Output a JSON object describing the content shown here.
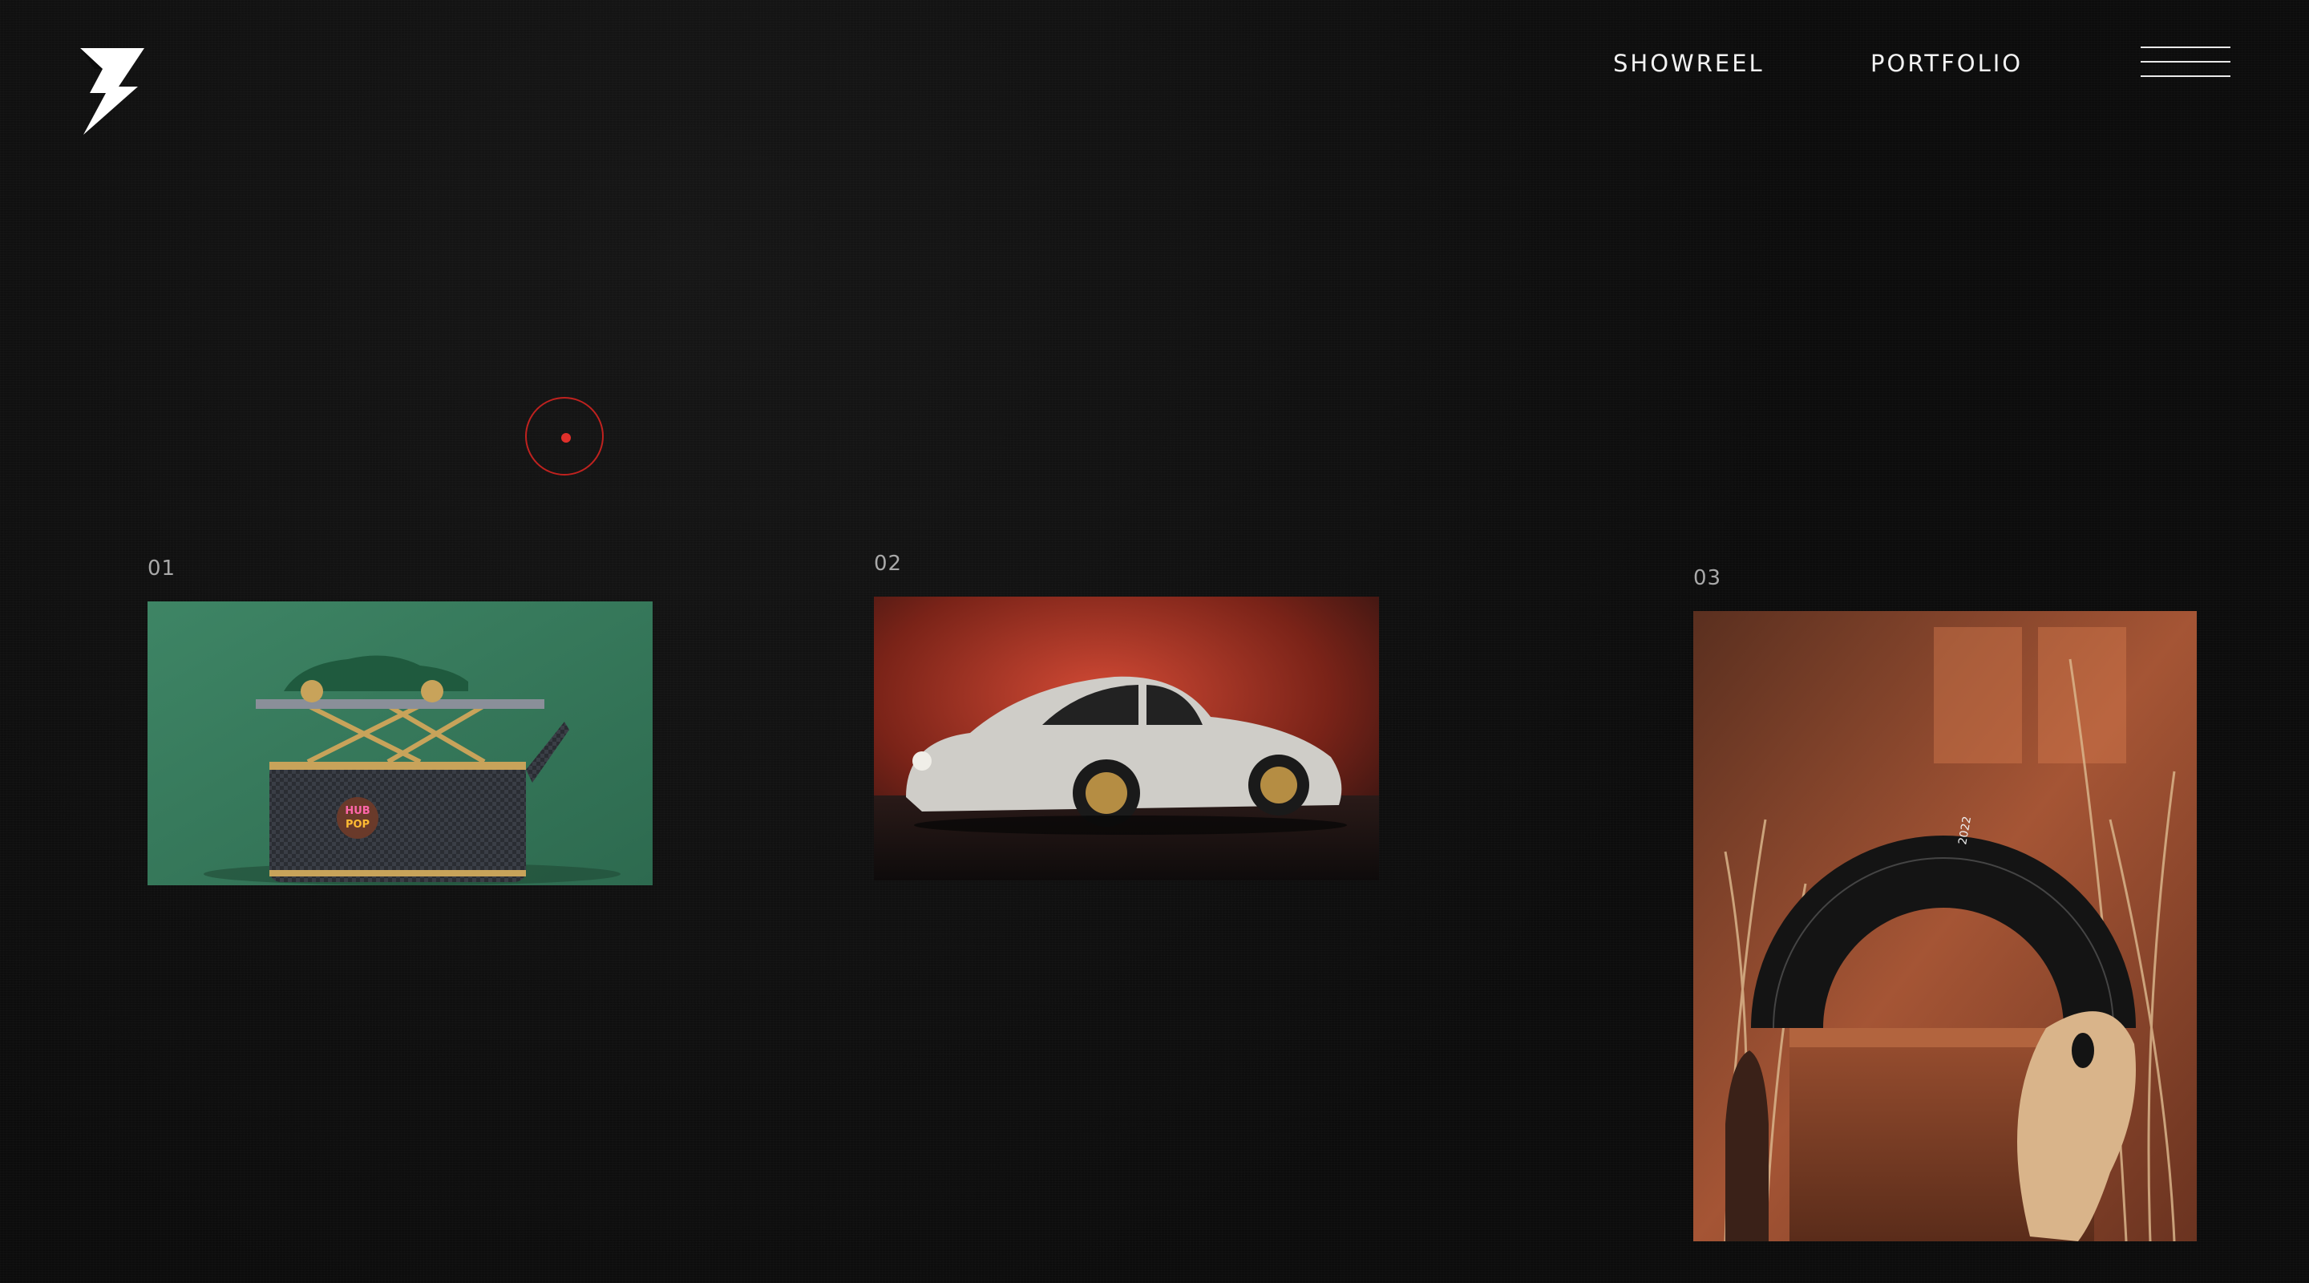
{
  "header": {
    "nav": [
      "SHOWREEL",
      "PORTFOLIO"
    ]
  },
  "projects": [
    {
      "number": "01"
    },
    {
      "number": "02"
    },
    {
      "number": "03"
    }
  ],
  "colors": {
    "background": "#0c0c0c",
    "text": "#f2f2f2",
    "accent": "#c0221f"
  },
  "icons": [
    "lightning-logo",
    "hamburger-menu"
  ]
}
